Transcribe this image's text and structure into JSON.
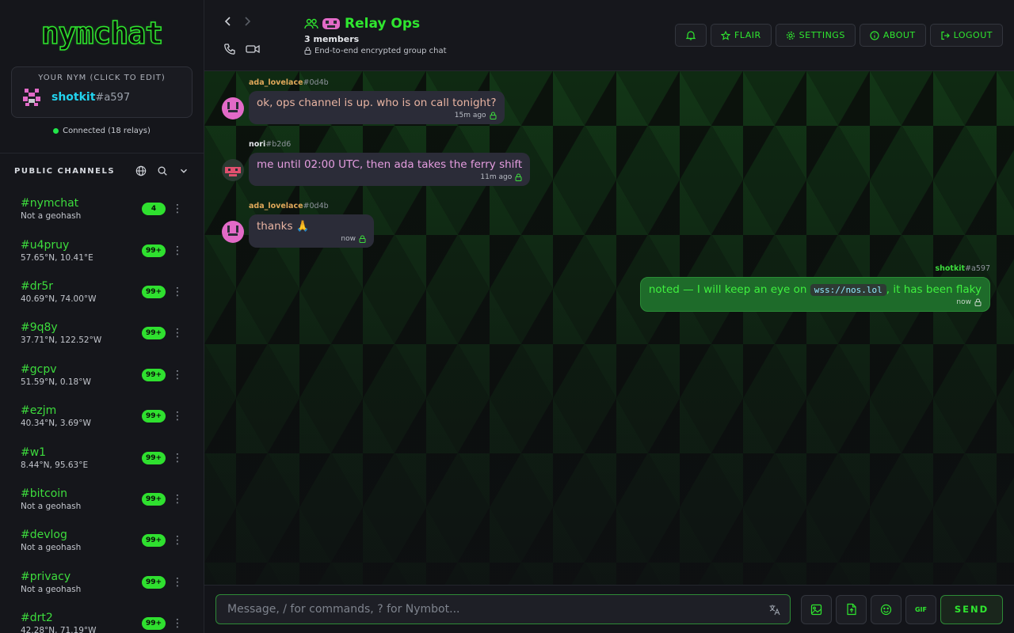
{
  "app": {
    "logo": "nymchat"
  },
  "nym_card": {
    "caption": "YOUR NYM (CLICK TO EDIT)",
    "name": "shotkit",
    "suffix": "#a597"
  },
  "connection": {
    "status": "Connected (18 relays)"
  },
  "channels_header": {
    "title": "PUBLIC CHANNELS"
  },
  "channels": [
    {
      "name": "#nymchat",
      "sub": "Not a geohash",
      "badge": "4"
    },
    {
      "name": "#u4pruy",
      "sub": "57.65°N, 10.41°E",
      "badge": "99+"
    },
    {
      "name": "#dr5r",
      "sub": "40.69°N, 74.00°W",
      "badge": "99+"
    },
    {
      "name": "#9q8y",
      "sub": "37.71°N, 122.52°W",
      "badge": "99+"
    },
    {
      "name": "#gcpv",
      "sub": "51.59°N, 0.18°W",
      "badge": "99+"
    },
    {
      "name": "#ezjm",
      "sub": "40.34°N, 3.69°W",
      "badge": "99+"
    },
    {
      "name": "#w1",
      "sub": "8.44°N, 95.63°E",
      "badge": "99+"
    },
    {
      "name": "#bitcoin",
      "sub": "Not a geohash",
      "badge": "99+"
    },
    {
      "name": "#devlog",
      "sub": "Not a geohash",
      "badge": "99+"
    },
    {
      "name": "#privacy",
      "sub": "Not a geohash",
      "badge": "99+"
    },
    {
      "name": "#drt2",
      "sub": "42.28°N, 71.19°W",
      "badge": "99+"
    }
  ],
  "group": {
    "name": "Relay Ops",
    "members": "3 members",
    "encryption": "End-to-end encrypted group chat"
  },
  "actions": {
    "flair": "FLAIR",
    "settings": "SETTINGS",
    "about": "ABOUT",
    "logout": "LOGOUT"
  },
  "messages": [
    {
      "user": "ada_lovelace",
      "tag": "#0d4b",
      "text": "ok, ops channel is up. who is on call tonight?",
      "time": "15m ago"
    },
    {
      "user": "nori",
      "tag": "#b2d6",
      "text": "me until 02:00 UTC, then ada takes the ferry shift",
      "time": "11m ago"
    },
    {
      "user": "ada_lovelace",
      "tag": "#0d4b",
      "text": "thanks 🙏",
      "time": "now"
    }
  ],
  "own_message": {
    "user": "shotkit",
    "tag": "#a597",
    "text_before": "noted — I will keep an eye on",
    "code": "wss://nos.lol",
    "text_after": ", it has been flaky",
    "time": "now"
  },
  "composer": {
    "placeholder": "Message, / for commands, ? for Nymbot...",
    "gif_label": "GIF",
    "send_label": "SEND"
  },
  "colors": {
    "accent": "#2fe62f",
    "nym": "#22d3ee",
    "bubble": "#2b2c38",
    "own_bubble": "#1e6b2a"
  },
  "icons": [
    "back-icon",
    "forward-icon",
    "phone-icon",
    "video-icon",
    "group-icon",
    "lock-icon",
    "bell-icon",
    "star-icon",
    "gear-icon",
    "info-icon",
    "logout-icon",
    "globe-icon",
    "search-icon",
    "chevron-down-icon",
    "translate-icon",
    "image-icon",
    "file-upload-icon",
    "emoji-icon",
    "kebab-icon"
  ]
}
